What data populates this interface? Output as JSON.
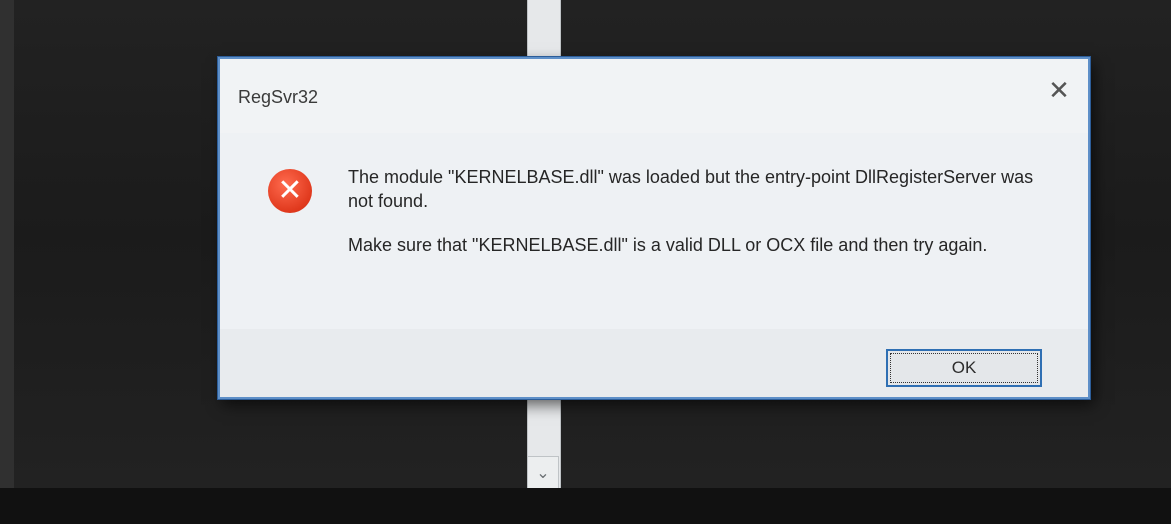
{
  "dialog": {
    "title": "RegSvr32",
    "close_label": "✕",
    "icon_glyph": "✕",
    "message_1": "The module \"KERNELBASE.dll\" was loaded but the entry-point DllRegisterServer was not found.",
    "message_2": "Make sure that \"KERNELBASE.dll\" is a valid DLL or OCX file and then try again.",
    "ok_label": "OK"
  },
  "background": {
    "scroll_down_glyph": "⌄"
  },
  "colors": {
    "error_icon": "#e0391d",
    "dialog_border": "#5e8fc8",
    "ok_border": "#2f6fb3"
  }
}
